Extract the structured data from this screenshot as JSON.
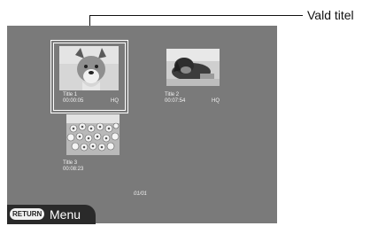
{
  "callout": {
    "label": "Vald titel"
  },
  "titles": [
    {
      "name": "Title 1",
      "duration": "00:00:05",
      "quality": "HQ",
      "thumbnail": "dog-face",
      "selected": true
    },
    {
      "name": "Title 2",
      "duration": "00:07:54",
      "quality": "HQ",
      "thumbnail": "dog-lying"
    },
    {
      "name": "Title 3",
      "duration": "00:08:23",
      "quality": "",
      "thumbnail": "flowers"
    }
  ],
  "page_indicator": "01/01",
  "footer": {
    "return_label": "RETURN",
    "menu_label": "Menu"
  },
  "colors": {
    "screen_bg": "#7a7a7a",
    "selection": "#ffffff",
    "footer_bg": "#2a2a2a"
  }
}
